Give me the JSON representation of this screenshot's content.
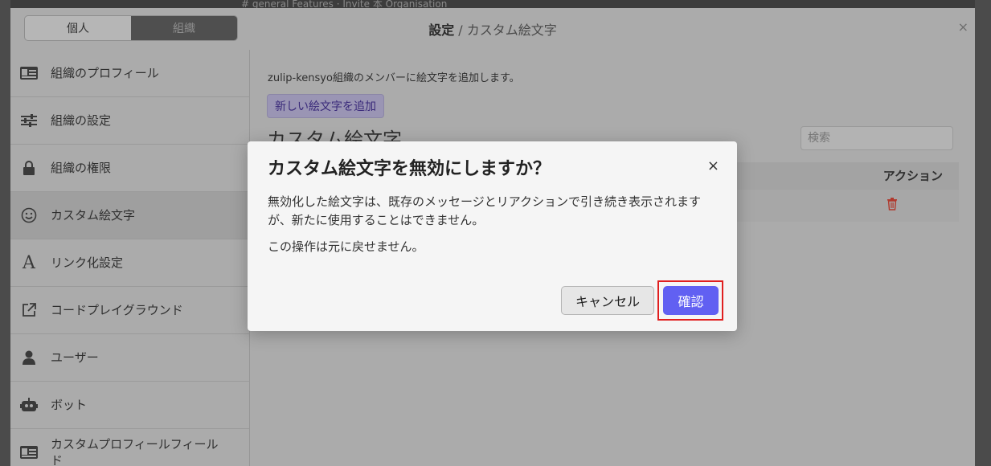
{
  "background": {
    "topbar_text": "# general  Features · Invite 本 Organisation"
  },
  "settings": {
    "toggle": {
      "personal": "個人",
      "organization": "組織"
    },
    "title_bold": "設定",
    "title_sep": " / ",
    "title_section": "カスタム絵文字",
    "close": "×"
  },
  "menu": {
    "items": [
      {
        "label": "組織のプロフィール",
        "icon": "id-card-icon"
      },
      {
        "label": "組織の設定",
        "icon": "sliders-icon"
      },
      {
        "label": "組織の権限",
        "icon": "lock-icon"
      },
      {
        "label": "カスタム絵文字",
        "icon": "smiley-icon"
      },
      {
        "label": "リンク化設定",
        "icon": "font-a-icon"
      },
      {
        "label": "コードプレイグラウンド",
        "icon": "external-link-icon"
      },
      {
        "label": "ユーザー",
        "icon": "user-icon"
      },
      {
        "label": "ボット",
        "icon": "robot-icon"
      },
      {
        "label": "カスタムプロフィールフィールド",
        "icon": "id-card-icon"
      }
    ]
  },
  "content": {
    "intro": "zulip-kensyo組織のメンバーに絵文字を追加します。",
    "add_button": "新しい絵文字を追加",
    "section_title": "カスタム絵文字",
    "search_placeholder": "検索",
    "column_action": "アクション"
  },
  "modal": {
    "title": "カスタム絵文字を無効にしますか？",
    "close": "×",
    "body_line1": "無効化した絵文字は、既存のメッセージとリアクションで引き続き表示されますが、新たに使用することはできません。",
    "body_line2": "この操作は元に戻せません。",
    "cancel": "キャンセル",
    "confirm": "確認"
  },
  "colors": {
    "confirm_bg": "#6160f2",
    "highlight": "#e01f1f",
    "trash": "#c0392b"
  }
}
